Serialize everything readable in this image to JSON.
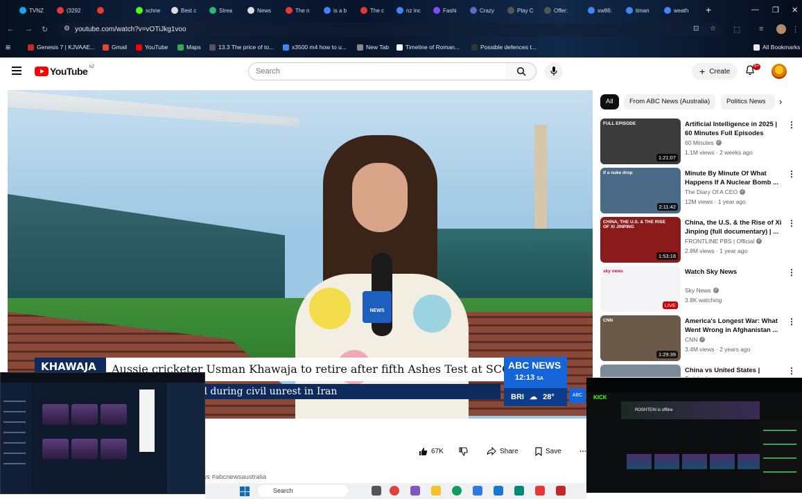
{
  "browser": {
    "tabs": [
      {
        "label": "TVNZ",
        "color": "#1da1f2"
      },
      {
        "label": "(3292",
        "color": "#e53935"
      },
      {
        "label": "",
        "color": "#e53935"
      },
      {
        "label": "schne",
        "color": "#53fc18"
      },
      {
        "label": "Best c",
        "color": "#dddddd"
      },
      {
        "label": "Strea",
        "color": "#2bb673"
      },
      {
        "label": "News",
        "color": "#dddddd"
      },
      {
        "label": "The n",
        "color": "#e53935"
      },
      {
        "label": "is a b",
        "color": "#4285f4"
      },
      {
        "label": "The c",
        "color": "#e53935"
      },
      {
        "label": "nz inc",
        "color": "#4285f4"
      },
      {
        "label": "Fashi",
        "color": "#7c4dff"
      },
      {
        "label": "Crazy",
        "color": "#5c6bc0"
      },
      {
        "label": "Play C",
        "color": "#555555"
      },
      {
        "label": "Offer:",
        "color": "#555555"
      },
      {
        "label": "xw86:",
        "color": "#4285f4"
      },
      {
        "label": "timan",
        "color": "#4285f4"
      },
      {
        "label": "weath",
        "color": "#4285f4"
      }
    ],
    "url": "youtube.com/watch?v=vOTiJkg1voo",
    "bookmarks": [
      {
        "label": "Genesis 7 | KJVAAE...",
        "color": "#c62828"
      },
      {
        "label": "Gmail",
        "color": "#ea4335"
      },
      {
        "label": "YouTube",
        "color": "#ff0000"
      },
      {
        "label": "Maps",
        "color": "#34a853"
      },
      {
        "label": "13.3 The price of to...",
        "color": "#555555"
      },
      {
        "label": "x3500 m4 how to u...",
        "color": "#4285f4"
      },
      {
        "label": "New Tab",
        "color": "#888888"
      },
      {
        "label": "Timeline of Roman...",
        "color": "#ffffff"
      },
      {
        "label": "Possible defences t...",
        "color": "#333333"
      }
    ],
    "all_bookmarks": "All Bookmarks"
  },
  "youtube": {
    "logo_text": "YouTube",
    "region": "NZ",
    "search_placeholder": "Search",
    "create_label": "Create",
    "notif_count": "9+"
  },
  "video": {
    "lower_third_name": "KHAWAJA",
    "lower_third_headline": "Aussie cricketer Usman Khawaja to retire after fifth Ashes Test at SCG",
    "lower_third_sub": "d during civil unrest in Iran",
    "abc_logo": "ABC NEWS",
    "abc_time": "12:13",
    "abc_tz": "SA",
    "abc_city": "BRI",
    "abc_temp": "28°",
    "mic_label": "NEWS"
  },
  "actions": {
    "likes": "67K",
    "share": "Share",
    "save": "Save",
    "hashtags": "ews #abcnewsaustralia"
  },
  "chips": [
    "All",
    "From ABC News (Australia)",
    "Politics News"
  ],
  "recommendations": [
    {
      "title": "Artificial Intelligence in 2025 | 60 Minutes Full Episodes",
      "channel": "60 Minutes",
      "meta": "1.1M views · 2 weeks ago",
      "duration": "1:21:07",
      "thumb": "#3b3b3b",
      "badge": "FULL EPISODE"
    },
    {
      "title": "Minute By Minute Of What Happens If A Nuclear Bomb ...",
      "channel": "The Diary Of A CEO",
      "meta": "12M views · 1 year ago",
      "duration": "2:11:42",
      "thumb": "#4a6a87",
      "badge": "if a nuke drop"
    },
    {
      "title": "China, the U.S. & the Rise of Xi Jinping (full documentary) | ...",
      "channel": "FRONTLINE PBS | Official",
      "meta": "2.8M views · 1 year ago",
      "duration": "1:53:18",
      "thumb": "#8b1a1a",
      "badge": "CHINA, THE U.S. & THE RISE OF XI JINPING"
    },
    {
      "title": "Watch Sky News",
      "channel": "Sky News",
      "meta": "3.8K watching",
      "duration": "LIVE",
      "thumb": "#f4f4f6",
      "badge": "sky news"
    },
    {
      "title": "America's Longest War: What Went Wrong in Afghanistan ...",
      "channel": "CNN",
      "meta": "3.4M views · 2 years ago",
      "duration": "1:29:39",
      "thumb": "#6b5a4a",
      "badge": "CNN"
    },
    {
      "title": "China vs United States | Behind",
      "channel": "",
      "meta": "",
      "duration": "",
      "thumb": "#7a8a99",
      "badge": ""
    }
  ],
  "kick": {
    "logo": "KICK",
    "banner": "ROSHTEIN is offline"
  },
  "taskbar": {
    "search": "Search"
  }
}
